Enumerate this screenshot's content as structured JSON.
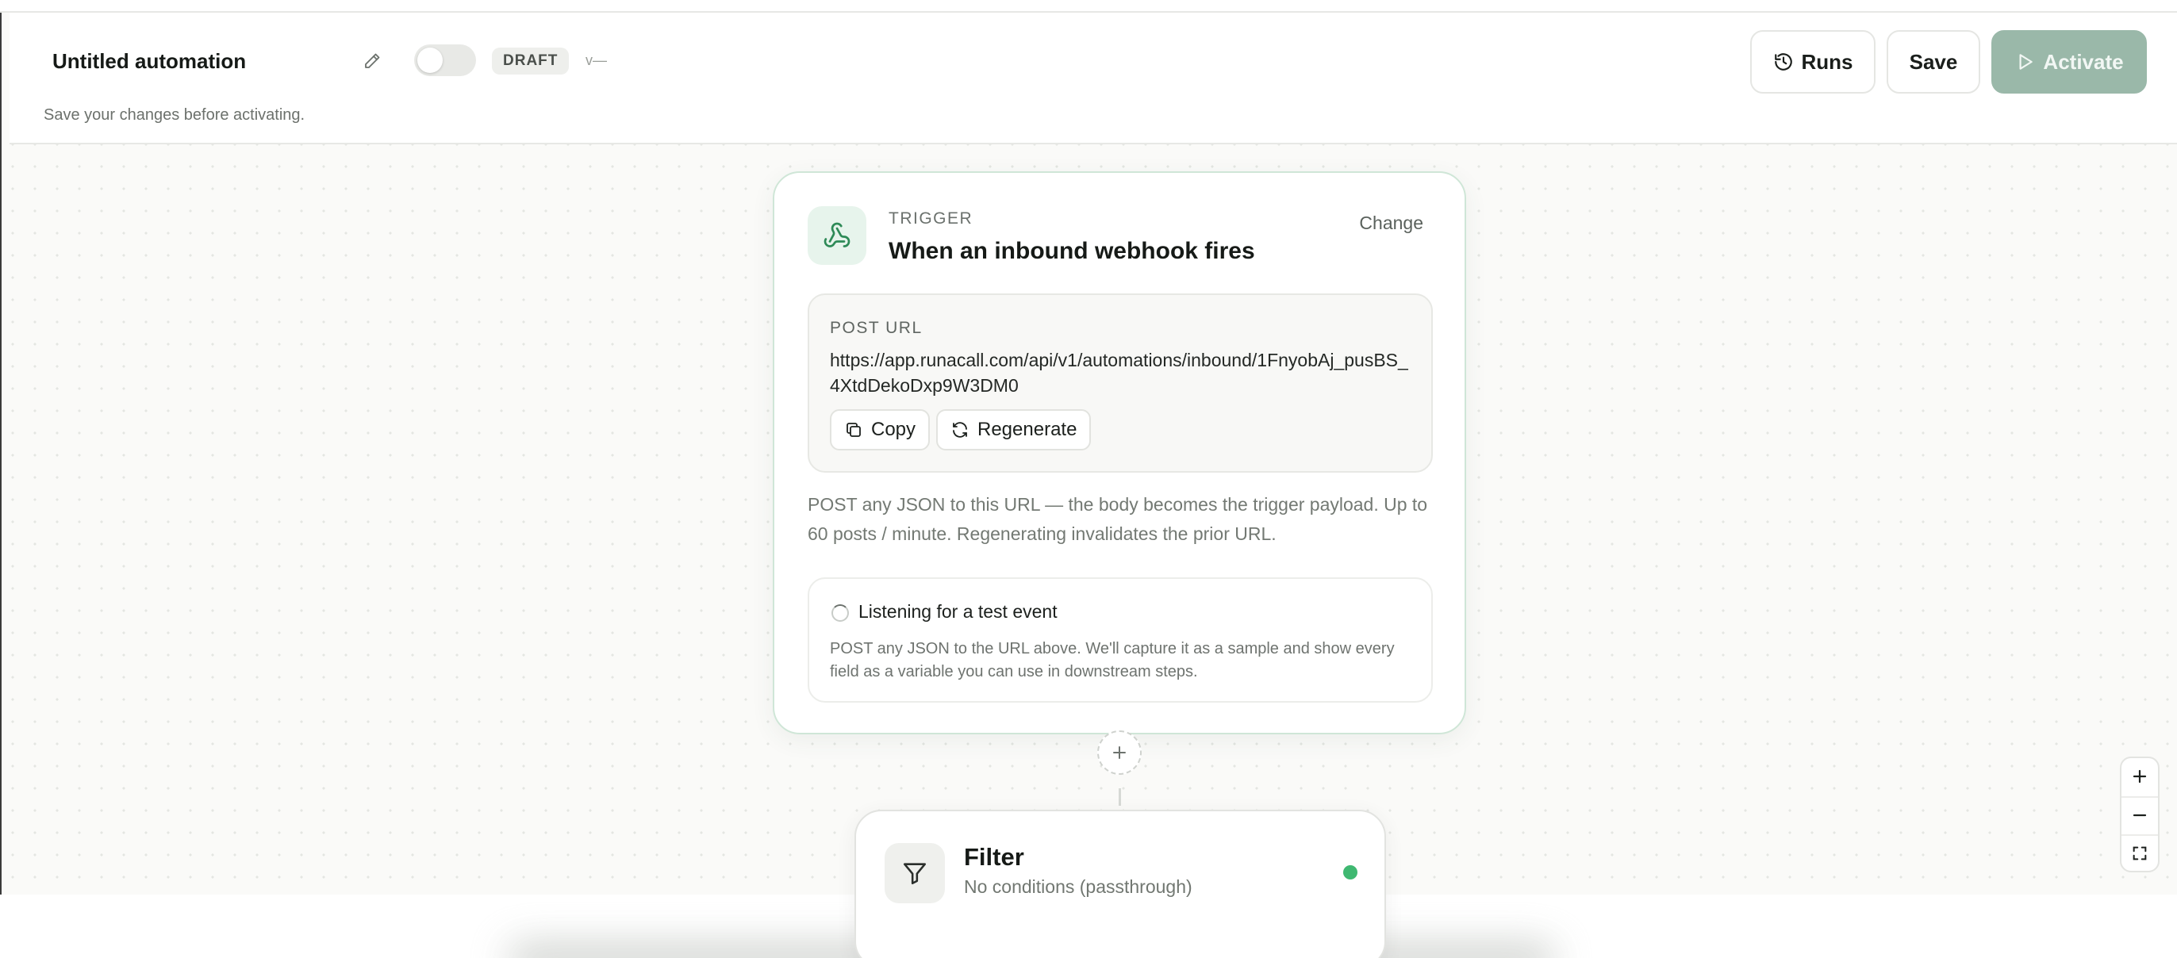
{
  "header": {
    "title": "Untitled automation",
    "status_badge": "DRAFT",
    "version": "v—",
    "hint": "Save your changes before activating.",
    "buttons": {
      "runs": "Runs",
      "save": "Save",
      "activate": "Activate"
    }
  },
  "trigger": {
    "kicker": "TRIGGER",
    "title": "When an inbound webhook fires",
    "change_label": "Change",
    "url_label": "POST URL",
    "url_value": "https://app.runacall.com/api/v1/automations/inbound/1FnyobAj_pusBS_4XtdDekoDxp9W3DM0",
    "copy_label": "Copy",
    "regenerate_label": "Regenerate",
    "description": "POST any JSON to this URL — the body becomes the trigger payload. Up to 60 posts / minute. Regenerating invalidates the prior URL.",
    "listening_title": "Listening for a test event",
    "listening_desc": "POST any JSON to the URL above. We'll capture it as a sample and show every field as a variable you can use in downstream steps."
  },
  "filter_step": {
    "title": "Filter",
    "subtitle": "No conditions (passthrough)",
    "status_color": "#3fb871"
  },
  "icons": {
    "edit": "pencil-icon",
    "runs": "history-icon",
    "activate": "play-icon",
    "trigger": "webhook-icon",
    "copy": "copy-icon",
    "regenerate": "refresh-icon",
    "add_step": "plus-icon",
    "filter": "funnel-icon",
    "zoom_in": "plus-icon",
    "zoom_out": "minus-icon",
    "fit": "fit-view-icon"
  },
  "colors": {
    "accent": "#3fb871",
    "activate_bg": "#9ab8a9",
    "trigger_border": "#cfe6d7"
  }
}
